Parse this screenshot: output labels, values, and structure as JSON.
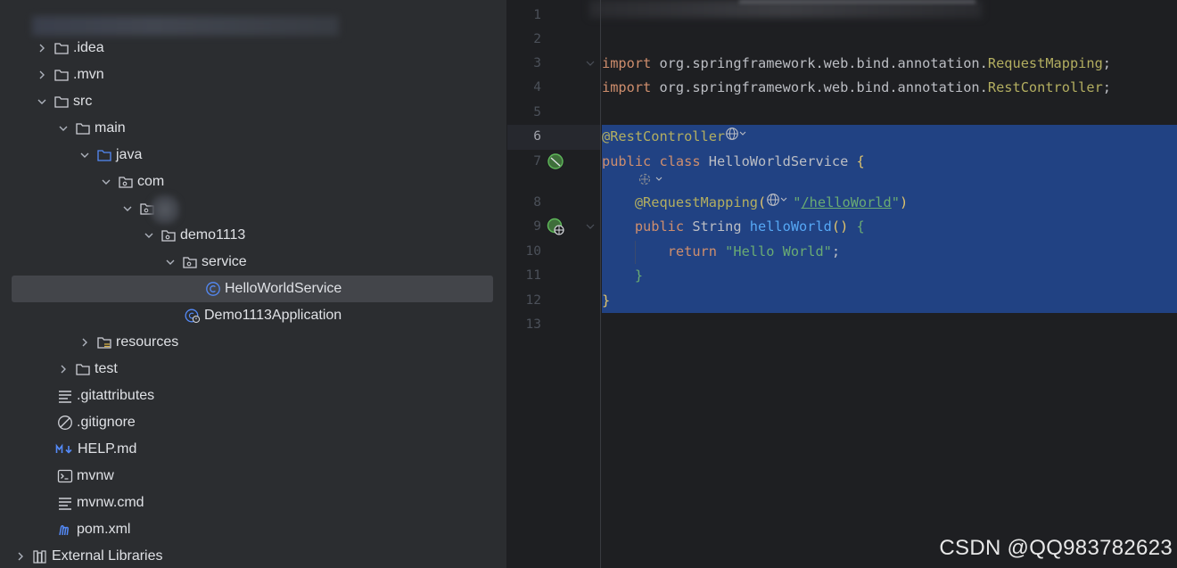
{
  "project_tree": {
    "items": [
      {
        "label": ".idea",
        "icon": "folder-icon",
        "expander": "collapsed"
      },
      {
        "label": ".mvn",
        "icon": "folder-icon",
        "expander": "collapsed"
      },
      {
        "label": "src",
        "icon": "folder-icon",
        "expander": "expanded"
      },
      {
        "label": "main",
        "icon": "folder-icon",
        "expander": "expanded"
      },
      {
        "label": "java",
        "icon": "source-folder-icon",
        "expander": "expanded"
      },
      {
        "label": "com",
        "icon": "package-icon",
        "expander": "expanded"
      },
      {
        "label": "",
        "icon": "package-icon",
        "expander": "expanded"
      },
      {
        "label": "demo1113",
        "icon": "package-icon",
        "expander": "expanded"
      },
      {
        "label": "service",
        "icon": "package-icon",
        "expander": "expanded"
      },
      {
        "label": "HelloWorldService",
        "icon": "class-icon",
        "expander": "none",
        "selected": true
      },
      {
        "label": "Demo1113Application",
        "icon": "spring-boot-app-icon",
        "expander": "none"
      },
      {
        "label": "resources",
        "icon": "resources-folder-icon",
        "expander": "collapsed"
      },
      {
        "label": "test",
        "icon": "folder-icon",
        "expander": "collapsed"
      },
      {
        "label": ".gitattributes",
        "icon": "text-file-icon",
        "expander": "none"
      },
      {
        "label": ".gitignore",
        "icon": "ignore-file-icon",
        "expander": "none"
      },
      {
        "label": "HELP.md",
        "icon": "markdown-file-icon",
        "expander": "none"
      },
      {
        "label": "mvnw",
        "icon": "shell-file-icon",
        "expander": "none"
      },
      {
        "label": "mvnw.cmd",
        "icon": "text-file-icon",
        "expander": "none"
      },
      {
        "label": "pom.xml",
        "icon": "maven-file-icon",
        "expander": "none"
      },
      {
        "label": "External Libraries",
        "icon": "libraries-icon",
        "expander": "collapsed"
      }
    ]
  },
  "editor": {
    "line_numbers": [
      "1",
      "2",
      "3",
      "4",
      "5",
      "6",
      "7",
      "8",
      "9",
      "10",
      "11",
      "12",
      "13"
    ],
    "active_line": "6",
    "code": {
      "import_kw": "import",
      "import1_pkg": " org.springframework.web.bind.annotation.",
      "import1_cls": "RequestMapping",
      "import2_pkg": " org.springframework.web.bind.annotation.",
      "import2_cls": "RestController",
      "semicolon": ";",
      "rest_controller": "@RestController",
      "public_kw": "public",
      "class_kw": "class",
      "class_name": " HelloWorldService ",
      "open_brace": "{",
      "request_mapping": "@RequestMapping",
      "paren_open": "(",
      "quote": "\"",
      "path": "/helloWorld",
      "paren_close": ")",
      "string_type": " String ",
      "method_name": "helloWorld",
      "method_parens": "()",
      "return_kw": "return",
      "return_value": "\"Hello World\"",
      "close_brace": "}"
    }
  },
  "colors": {
    "selection": "#214283",
    "keyword": "#cf8e6d",
    "annotation": "#b3ae60",
    "string": "#6aab73",
    "method": "#56a8f5"
  },
  "watermark": "CSDN @QQ983782623"
}
